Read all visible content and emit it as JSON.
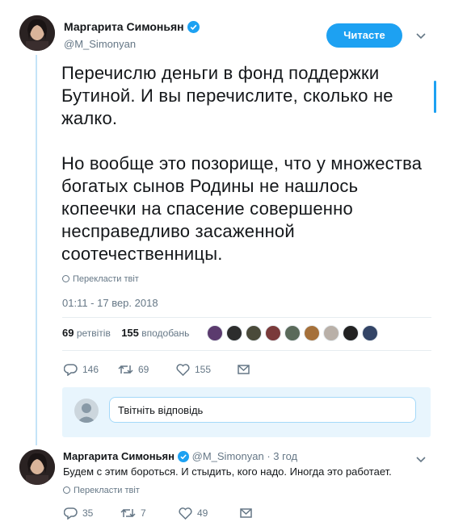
{
  "tweet": {
    "author_name": "Маргарита Симоньян",
    "author_handle": "@M_Simonyan",
    "follow_label": "Читасте",
    "text": "Перечислю деньги в фонд поддержки Бутиной. И вы перечислите, сколько не жалко.\n\nНо вообще это позорище, что у множества богатых сынов Родины не нашлось копеечки на спасение совершенно несправедливо засаженной соотечественницы.",
    "translate_label": "Перекласти твіт",
    "timestamp": "01:11 - 17 вер. 2018",
    "retweets_count": "69",
    "retweets_label": "ретвітів",
    "likes_count": "155",
    "likes_label": "вподобань",
    "actions": {
      "replies": "146",
      "retweets": "69",
      "likes": "155"
    }
  },
  "reply_box": {
    "placeholder": "Твітніть відповідь"
  },
  "reply": {
    "author_name": "Маргарита Симоньян",
    "author_handle": "@M_Simonyan",
    "time": "· 3 год",
    "text": "Будем с этим бороться. И стыдить, кого надо. Иногда это работает.",
    "translate_label": "Перекласти твіт",
    "actions": {
      "replies": "35",
      "retweets": "7",
      "likes": "49"
    }
  },
  "colors": {
    "accent": "#1da1f2",
    "text": "#14171a",
    "muted": "#657786",
    "thread": "#c4e3f8"
  },
  "likers": [
    "#5b3b6e",
    "#2d2d2d",
    "#4a4a3a",
    "#7a3a3a",
    "#5a6a5a",
    "#a5703a",
    "#b9b0a8",
    "#222222",
    "#334466"
  ]
}
